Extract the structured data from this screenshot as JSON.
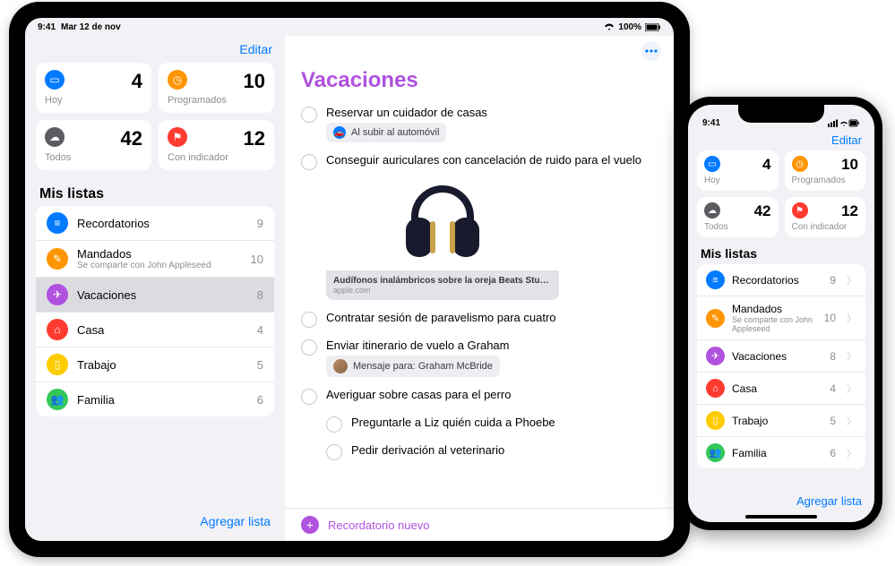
{
  "ipad": {
    "status": {
      "time": "9:41",
      "date": "Mar 12 de nov",
      "battery": "100%"
    },
    "edit_label": "Editar",
    "cards": [
      {
        "icon": "calendar",
        "color": "#007aff",
        "label": "Hoy",
        "count": 4
      },
      {
        "icon": "clock",
        "color": "#ff9500",
        "label": "Programados",
        "count": 10
      },
      {
        "icon": "tray",
        "color": "#5b5b60",
        "label": "Todos",
        "count": 42
      },
      {
        "icon": "flag",
        "color": "#ff3b30",
        "label": "Con indicador",
        "count": 12
      }
    ],
    "lists_title": "Mis listas",
    "lists": [
      {
        "name": "Recordatorios",
        "count": 9,
        "color": "#007aff",
        "icon": "list"
      },
      {
        "name": "Mandados",
        "count": 10,
        "color": "#ff9500",
        "icon": "pencil",
        "subtitle": "Se comparte con John Appleseed"
      },
      {
        "name": "Vacaciones",
        "count": 8,
        "color": "#af52de",
        "icon": "plane",
        "selected": true
      },
      {
        "name": "Casa",
        "count": 4,
        "color": "#ff3b30",
        "icon": "home"
      },
      {
        "name": "Trabajo",
        "count": 5,
        "color": "#ffcc00",
        "icon": "briefcase"
      },
      {
        "name": "Familia",
        "count": 6,
        "color": "#34c759",
        "icon": "people"
      }
    ],
    "add_list_label": "Agregar lista",
    "detail": {
      "title": "Vacaciones",
      "tasks": [
        {
          "title": "Reservar un cuidador de casas",
          "chip": {
            "icon": "car",
            "icon_color": "#007aff",
            "text": "Al subir al automóvil"
          }
        },
        {
          "title": "Conseguir auriculares con cancelación de ruido para el vuelo",
          "rich": {
            "title": "Audífonos inalámbricos sobre la oreja Beats Studio3…",
            "source": "apple.com"
          }
        },
        {
          "title": "Contratar sesión de paravelismo para cuatro"
        },
        {
          "title": "Enviar itinerario de vuelo a Graham",
          "chip": {
            "avatar": true,
            "text": "Mensaje para: Graham McBride"
          }
        },
        {
          "title": "Averiguar sobre casas para el perro",
          "subtasks": [
            "Preguntarle a Liz quién cuida a Phoebe",
            "Pedir derivación al veterinario"
          ]
        }
      ],
      "new_label": "Recordatorio nuevo"
    }
  },
  "iphone": {
    "status": {
      "time": "9:41"
    },
    "edit_label": "Editar",
    "cards": [
      {
        "icon": "calendar",
        "color": "#007aff",
        "label": "Hoy",
        "count": 4
      },
      {
        "icon": "clock",
        "color": "#ff9500",
        "label": "Programados",
        "count": 10
      },
      {
        "icon": "tray",
        "color": "#5b5b60",
        "label": "Todos",
        "count": 42
      },
      {
        "icon": "flag",
        "color": "#ff3b30",
        "label": "Con indicador",
        "count": 12
      }
    ],
    "lists_title": "Mis listas",
    "lists": [
      {
        "name": "Recordatorios",
        "count": 9,
        "color": "#007aff",
        "icon": "list"
      },
      {
        "name": "Mandados",
        "count": 10,
        "color": "#ff9500",
        "icon": "pencil",
        "subtitle": "Se comparte con John Appleseed"
      },
      {
        "name": "Vacaciones",
        "count": 8,
        "color": "#af52de",
        "icon": "plane"
      },
      {
        "name": "Casa",
        "count": 4,
        "color": "#ff3b30",
        "icon": "home"
      },
      {
        "name": "Trabajo",
        "count": 5,
        "color": "#ffcc00",
        "icon": "briefcase"
      },
      {
        "name": "Familia",
        "count": 6,
        "color": "#34c759",
        "icon": "people"
      }
    ],
    "add_list_label": "Agregar lista"
  },
  "glyphs": {
    "calendar": "▭",
    "clock": "◷",
    "tray": "☁",
    "flag": "⚑",
    "list": "≡",
    "pencil": "✎",
    "plane": "✈",
    "home": "⌂",
    "briefcase": "▯",
    "people": "👥",
    "car": "🚗"
  }
}
